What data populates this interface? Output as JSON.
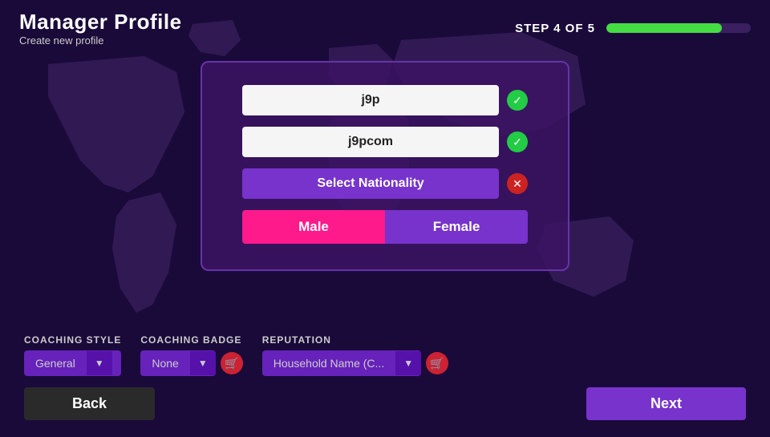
{
  "header": {
    "title": "Manager Profile",
    "subtitle": "Create new profile",
    "step_text": "STEP 4 OF 5",
    "progress_percent": 80
  },
  "form": {
    "field1_value": "j9p",
    "field2_value": "j9pcom",
    "nationality_placeholder": "Select Nationality",
    "gender_male": "Male",
    "gender_female": "Female"
  },
  "coaching": {
    "style_label": "COACHING STYLE",
    "style_value": "General",
    "badge_label": "COACHING BADGE",
    "badge_value": "None",
    "reputation_label": "REPUTATION",
    "reputation_value": "Household Name (C..."
  },
  "actions": {
    "back_label": "Back",
    "next_label": "Next"
  },
  "icons": {
    "checkmark": "✓",
    "cross": "✕",
    "arrow_down": "▼",
    "cart": "🛒"
  }
}
